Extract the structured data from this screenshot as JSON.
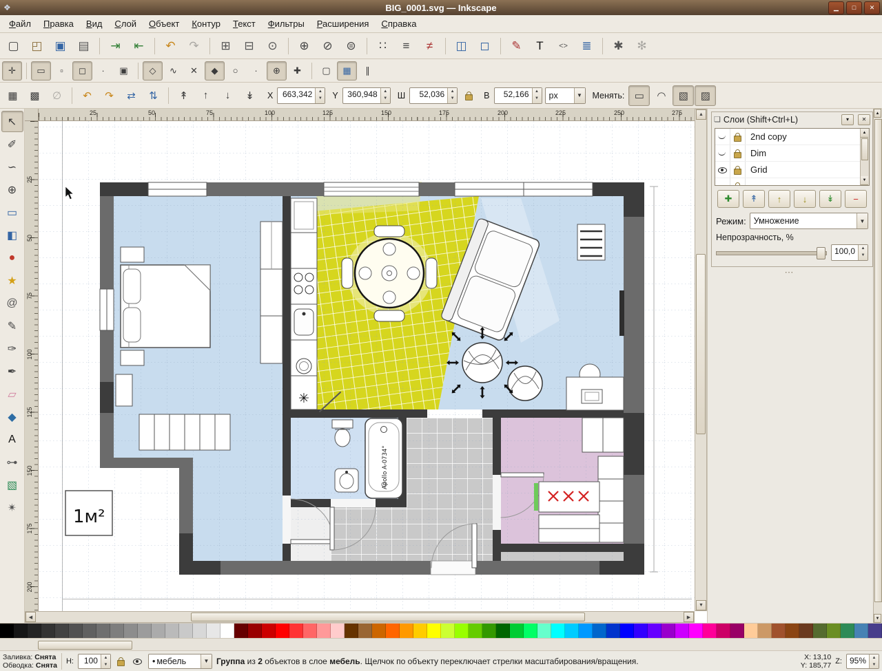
{
  "window": {
    "title": "BIG_0001.svg — Inkscape",
    "icon_glyph": "❖",
    "minimize_glyph": "▁",
    "maximize_glyph": "□",
    "close_glyph": "✕"
  },
  "menu": [
    {
      "head": "Ф",
      "tail": "айл"
    },
    {
      "head": "П",
      "tail": "равка"
    },
    {
      "head": "В",
      "tail": "ид"
    },
    {
      "head": "С",
      "tail": "лой"
    },
    {
      "head": "О",
      "tail": "бъект"
    },
    {
      "head": "К",
      "tail": "онтур"
    },
    {
      "head": "Т",
      "tail": "екст"
    },
    {
      "head": "Ф",
      "tail": "ильтры"
    },
    {
      "head": "Р",
      "tail": "асширения"
    },
    {
      "head": "С",
      "tail": "правка"
    }
  ],
  "commands_toolbar": [
    {
      "name": "new-document-button",
      "glyph": "▢",
      "color": "#444"
    },
    {
      "name": "open-document-button",
      "glyph": "◰",
      "color": "#8a6d3b"
    },
    {
      "name": "save-document-button",
      "glyph": "▣",
      "color": "#3465a4"
    },
    {
      "name": "print-document-button",
      "glyph": "▤",
      "color": "#555"
    },
    {
      "sep": true
    },
    {
      "name": "import-bitmap-button",
      "glyph": "⇥",
      "color": "#2e7d32"
    },
    {
      "name": "export-bitmap-button",
      "glyph": "⇤",
      "color": "#2e7d32"
    },
    {
      "sep": true
    },
    {
      "name": "undo-button",
      "glyph": "↶",
      "color": "#c8861a"
    },
    {
      "name": "redo-button",
      "glyph": "↷",
      "disabled": true
    },
    {
      "sep": true
    },
    {
      "name": "copy-button",
      "glyph": "⊞",
      "color": "#555"
    },
    {
      "name": "paste-button",
      "glyph": "⊟",
      "color": "#555"
    },
    {
      "name": "find-button",
      "glyph": "⊙",
      "color": "#555"
    },
    {
      "sep": true
    },
    {
      "name": "zoom-selection-button",
      "glyph": "⊕",
      "color": "#444"
    },
    {
      "name": "zoom-drawing-button",
      "glyph": "⊘",
      "color": "#444"
    },
    {
      "name": "zoom-page-button",
      "glyph": "⊜",
      "color": "#444"
    },
    {
      "sep": true
    },
    {
      "name": "duplicate-button",
      "glyph": "∷",
      "color": "#444"
    },
    {
      "name": "create-clone-button",
      "glyph": "≡",
      "color": "#444"
    },
    {
      "name": "unlink-clone-button",
      "glyph": "≠",
      "color": "#a33"
    },
    {
      "sep": true
    },
    {
      "name": "group-objects-button",
      "glyph": "◫",
      "color": "#3465a4"
    },
    {
      "name": "ungroup-objects-button",
      "glyph": "◻",
      "color": "#3465a4"
    },
    {
      "sep": true
    },
    {
      "name": "fill-stroke-dialog-button",
      "glyph": "✎",
      "color": "#a33"
    },
    {
      "name": "text-dialog-button",
      "glyph": "T",
      "color": "#111"
    },
    {
      "name": "xml-editor-button",
      "glyph": "<>",
      "color": "#555",
      "fs": 11
    },
    {
      "name": "align-distribute-dialog-button",
      "glyph": "≣",
      "color": "#3465a4"
    },
    {
      "sep": true
    },
    {
      "name": "document-properties-button",
      "glyph": "✱",
      "color": "#555"
    },
    {
      "name": "inkscape-preferences-button",
      "glyph": "✻",
      "disabled": true
    }
  ],
  "snap_toolbar": [
    {
      "name": "snap-master-toggle",
      "glyph": "✛",
      "pressed": true
    },
    {
      "sep": true
    },
    {
      "name": "snap-bbox-toggle",
      "glyph": "▭",
      "pressed": true
    },
    {
      "name": "snap-bbox-edges-toggle",
      "glyph": "▫"
    },
    {
      "name": "snap-bbox-corners-toggle",
      "glyph": "◻",
      "pressed": true
    },
    {
      "name": "snap-bbox-edge-midpoints-toggle",
      "glyph": "∙"
    },
    {
      "name": "snap-bbox-centers-toggle",
      "glyph": "▣"
    },
    {
      "sep": true
    },
    {
      "name": "snap-nodes-toggle",
      "glyph": "◇",
      "pressed": true
    },
    {
      "name": "snap-paths-toggle",
      "glyph": "∿"
    },
    {
      "name": "snap-path-intersections-toggle",
      "glyph": "✕"
    },
    {
      "name": "snap-cusp-nodes-toggle",
      "glyph": "◆",
      "pressed": true
    },
    {
      "name": "snap-smooth-nodes-toggle",
      "glyph": "○"
    },
    {
      "name": "snap-midpoints-toggle",
      "glyph": "·"
    },
    {
      "name": "snap-object-centers-toggle",
      "glyph": "⊕",
      "pressed": true
    },
    {
      "name": "snap-rotation-centers-toggle",
      "glyph": "✚"
    },
    {
      "sep": true
    },
    {
      "name": "snap-page-border-toggle",
      "glyph": "▢"
    },
    {
      "name": "snap-grid-toggle",
      "glyph": "▦",
      "pressed": true,
      "color": "#3465a4"
    },
    {
      "name": "snap-guides-toggle",
      "glyph": "∥"
    }
  ],
  "toolbox": [
    {
      "name": "selector-tool",
      "glyph": "↖",
      "pressed": true
    },
    {
      "name": "node-tool",
      "glyph": "✐"
    },
    {
      "name": "tweak-tool",
      "glyph": "∽"
    },
    {
      "name": "zoom-tool",
      "glyph": "⊕"
    },
    {
      "name": "rectangle-tool",
      "glyph": "▭",
      "color": "#3465a4"
    },
    {
      "name": "box3d-tool",
      "glyph": "◧",
      "color": "#3465a4"
    },
    {
      "name": "ellipse-tool",
      "glyph": "●",
      "color": "#c0392b"
    },
    {
      "name": "star-tool",
      "glyph": "★",
      "color": "#d4a017"
    },
    {
      "name": "spiral-tool",
      "glyph": "@",
      "color": "#555"
    },
    {
      "name": "pencil-tool",
      "glyph": "✎",
      "color": "#444"
    },
    {
      "name": "pen-tool",
      "glyph": "✑",
      "color": "#444"
    },
    {
      "name": "calligraphy-tool",
      "glyph": "✒",
      "color": "#444"
    },
    {
      "name": "eraser-tool",
      "glyph": "▱",
      "color": "#d17f9e"
    },
    {
      "name": "paint-bucket-tool",
      "glyph": "◆",
      "color": "#2e6da4"
    },
    {
      "name": "text-tool",
      "glyph": "A",
      "color": "#111"
    },
    {
      "name": "connector-tool",
      "glyph": "⊶",
      "color": "#555"
    },
    {
      "name": "gradient-tool",
      "glyph": "▧",
      "color": "#2e8b57"
    },
    {
      "name": "dropper-tool",
      "glyph": "✴",
      "color": "#555"
    }
  ],
  "tool_options": {
    "lead_buttons": [
      {
        "name": "select-all-button",
        "glyph": "▦"
      },
      {
        "name": "select-all-layers-button",
        "glyph": "▩"
      },
      {
        "name": "deselect-button",
        "glyph": "∅",
        "disabled": true
      },
      {
        "sep": true
      },
      {
        "name": "rotate-90-ccw-button",
        "glyph": "↶",
        "color": "#c8861a"
      },
      {
        "name": "rotate-90-cw-button",
        "glyph": "↷",
        "color": "#c8861a"
      },
      {
        "name": "flip-horizontal-button",
        "glyph": "⇄",
        "color": "#3465a4"
      },
      {
        "name": "flip-vertical-button",
        "glyph": "⇅",
        "color": "#3465a4"
      },
      {
        "sep": true
      },
      {
        "name": "raise-to-top-button",
        "glyph": "↟"
      },
      {
        "name": "raise-button",
        "glyph": "↑"
      },
      {
        "name": "lower-button",
        "glyph": "↓"
      },
      {
        "name": "lower-to-bottom-button",
        "glyph": "↡"
      }
    ],
    "x_label": "X",
    "x_value": "663,342",
    "y_label": "Y",
    "y_value": "360,948",
    "w_label": "Ш",
    "w_value": "52,036",
    "h_label": "В",
    "h_value": "52,166",
    "units_value": "px",
    "affect_label": "Менять:",
    "affect_buttons": [
      {
        "name": "affect-stroke-width-toggle",
        "glyph": "▭",
        "pressed": true
      },
      {
        "name": "affect-rounded-corners-toggle",
        "glyph": "◠"
      },
      {
        "name": "affect-gradients-toggle",
        "glyph": "▧",
        "pressed": true
      },
      {
        "name": "affect-patterns-toggle",
        "glyph": "▨",
        "pressed": true
      }
    ]
  },
  "rulers": {
    "h": [
      "25",
      "50",
      "75",
      "100",
      "125",
      "150",
      "175",
      "200",
      "225",
      "250",
      "275"
    ],
    "v": [
      "25",
      "50",
      "75",
      "100",
      "125",
      "150",
      "175",
      "200"
    ]
  },
  "floorplan": {
    "scale_label": "1м²",
    "bathtub_label": "Apollo A-0734°",
    "asterisk_glyph": "✳",
    "colors": {
      "room_blue": "#c8dcee",
      "bath_blue": "#cfe0f2",
      "kitchen_yellow": "#d6d61e",
      "hall_gray": "#c9c9c9",
      "room_pink": "#dcc3db",
      "wall": "#6b6b6b",
      "wall_dark": "#3c3c3c"
    }
  },
  "layers_panel": {
    "icon_glyph": "❏",
    "title": "Слои (Shift+Ctrl+L)",
    "shade_glyph": "▾",
    "close_glyph": "✕",
    "rows": [
      {
        "label": "2nd copy",
        "eye": "closed"
      },
      {
        "label": "Dim",
        "eye": "closed"
      },
      {
        "label": "Grid",
        "eye": "open"
      },
      {
        "label": "",
        "eye": "closed"
      }
    ],
    "buttons": [
      {
        "name": "new-layer-button",
        "glyph": "✚",
        "color": "#2e8b2e"
      },
      {
        "name": "raise-layer-to-top-button",
        "glyph": "↟",
        "color": "#3465a4"
      },
      {
        "name": "raise-layer-button",
        "glyph": "↑",
        "color": "#9a8c1a"
      },
      {
        "name": "lower-layer-button",
        "glyph": "↓",
        "color": "#9a8c1a"
      },
      {
        "name": "lower-layer-to-bottom-button",
        "glyph": "↡",
        "color": "#2e8b2e"
      },
      {
        "name": "delete-layer-button",
        "glyph": "−",
        "color": "#cc2222"
      }
    ],
    "mode_label": "Режим:",
    "mode_value": "Умножение",
    "opacity_label": "Непрозрачность, %",
    "opacity_value": "100,0",
    "dock_handle_glyph": "⋯"
  },
  "scroll": {
    "up": "▲",
    "down": "▼",
    "left": "◀",
    "right": "▶"
  },
  "palette": {
    "colors": [
      "#000000",
      "#161616",
      "#242424",
      "#333333",
      "#424242",
      "#515151",
      "#606060",
      "#6f6f6f",
      "#7e7e7e",
      "#8d8d8d",
      "#9c9c9c",
      "#ababab",
      "#bababa",
      "#c9c9c9",
      "#d8d8d8",
      "#e7e7e7",
      "#ffffff",
      "#660000",
      "#990000",
      "#cc0000",
      "#ff0000",
      "#ff3333",
      "#ff6666",
      "#ff9999",
      "#ffcccc",
      "#663300",
      "#996633",
      "#cc6600",
      "#ff6600",
      "#ff9900",
      "#ffcc00",
      "#ffff00",
      "#ccff33",
      "#99ff00",
      "#66cc00",
      "#339900",
      "#006600",
      "#00cc33",
      "#00ff66",
      "#66ffcc",
      "#00ffff",
      "#00ccff",
      "#0099ff",
      "#0066cc",
      "#0033cc",
      "#0000ff",
      "#3300ff",
      "#6600ff",
      "#9900cc",
      "#cc00ff",
      "#ff00ff",
      "#ff0099",
      "#cc0066",
      "#990066",
      "#ffcc99",
      "#cc9966",
      "#a0522d",
      "#8b4513",
      "#6b3a1f",
      "#556b2f",
      "#6b8e23",
      "#2e8b57",
      "#4682b4",
      "#483d8b"
    ]
  },
  "statusbar": {
    "fill_label": "Заливка:",
    "fill_value": "Снята",
    "stroke_label": "Обводка:",
    "stroke_value": "Снята",
    "opacity_label": "Н:",
    "opacity_value": "100",
    "layer_bullet": "•",
    "layer_name": "мебель",
    "message": [
      {
        "t": "Группа",
        "b": true
      },
      {
        "t": " из "
      },
      {
        "t": "2",
        "b": true
      },
      {
        "t": " объектов в слое "
      },
      {
        "t": "мебель",
        "b": true
      },
      {
        "t": ". Щелчок по объекту переключает стрелки масштабирования/вращения."
      }
    ],
    "x_label": "X:",
    "x_value": "13,10",
    "y_label": "Y:",
    "y_value": "185,77",
    "zoom_label": "Z:",
    "zoom_value": "95%"
  }
}
